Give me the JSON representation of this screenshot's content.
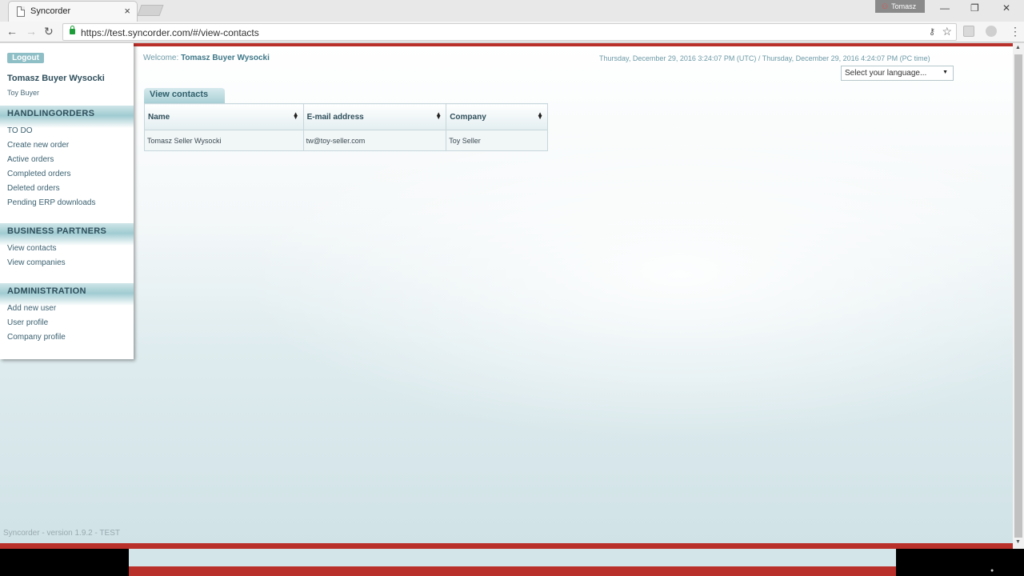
{
  "browser": {
    "tab_title": "Syncorder",
    "tab_close": "×",
    "profile_name": "Tomasz",
    "url": "https://test.syncorder.com/#/view-contacts",
    "controls": {
      "minimize": "—",
      "restore": "❐",
      "close": "✕"
    },
    "icons": [
      "back-arrow-icon",
      "forward-arrow-icon",
      "reload-icon",
      "lock-icon",
      "key-icon",
      "star-icon",
      "menu-icon"
    ]
  },
  "sidebar": {
    "logout_label": "Logout",
    "user_name": "Tomasz Buyer Wysocki",
    "user_role": "Toy Buyer",
    "sections": [
      {
        "title": "HANDLINGORDERS",
        "items": [
          "TO DO",
          "Create new order",
          "Active orders",
          "Completed orders",
          "Deleted orders",
          "Pending ERP downloads"
        ]
      },
      {
        "title": "BUSINESS PARTNERS",
        "items": [
          "View contacts",
          "View companies"
        ]
      },
      {
        "title": "ADMINISTRATION",
        "items": [
          "Add new user",
          "User profile",
          "Company profile"
        ]
      }
    ]
  },
  "header": {
    "welcome_label": "Welcome:",
    "welcome_name": "Tomasz Buyer Wysocki",
    "datetime": "Thursday, December 29, 2016 3:24:07 PM (UTC) / Thursday, December 29, 2016 4:24:07 PM (PC time)",
    "language_select": "Select your language..."
  },
  "contacts": {
    "tab_label": "View contacts",
    "columns": [
      "Name",
      "E-mail address",
      "Company"
    ],
    "rows": [
      [
        "Tomasz Seller Wysocki",
        "tw@toy-seller.com",
        "Toy Seller"
      ]
    ]
  },
  "footer": {
    "version": "Syncorder - version 1.9.2 - TEST"
  },
  "colors": {
    "accent_red": "#b9302a",
    "section_teal": "#9fcbd1",
    "text_dark_teal": "#2f4f5c"
  }
}
